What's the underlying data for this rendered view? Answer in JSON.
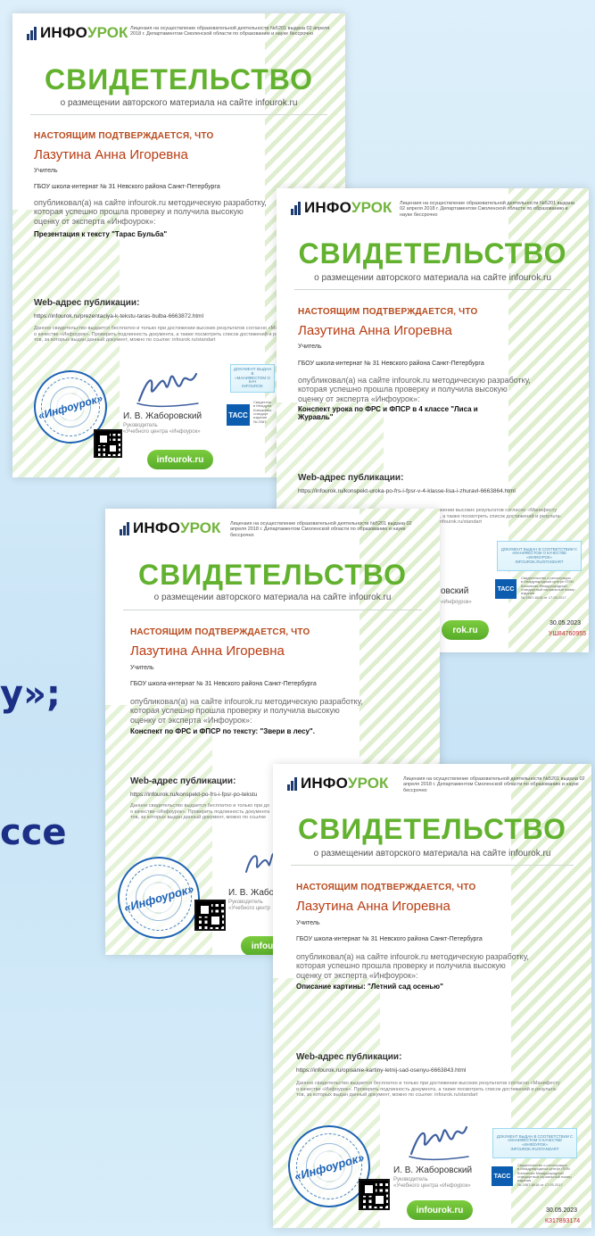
{
  "background": {
    "fragments": [
      "у»;",
      "ссе"
    ]
  },
  "certificates": [
    {
      "logo": {
        "brand_main": "ИНФО",
        "brand_accent": "УРОК"
      },
      "license_text": "Лицензия на осуществление образовательной деятельности №5201 выдана 02 апреля 2018 г.\nДепартаментом Смоленской области по образованию и науке бессрочно",
      "title": "СВИДЕТЕЛЬСТВО",
      "subtitle": "о размещении авторского материала на сайте infourok.ru",
      "confirm": "НАСТОЯЩИМ ПОДТВЕРЖДАЕТСЯ, ЧТО",
      "name": "Лазутина Анна Игоревна",
      "role": "Учитель",
      "school": "ГБОУ школа-интернат № 31 Невского района Санкт-Петербурга",
      "body": "опубликовал(а) на сайте infourok.ru методическую разработку,\nкоторая успешно прошла проверку и получила высокую\nоценку от эксперта «Инфоурок»:",
      "work": "Презентация к тексту \"Тарас Бульба\"",
      "web_label": "Web-адрес публикации:",
      "url": "https://infourok.ru/prezentaciya-k-tekstu-taras-bulba-6663872.html",
      "disclaimer": "Данное свидетельство выдается бесплатно и только при достижении высоких результатов согласно «Манифесту\nо качестве «Инфоурок». Проверить подлинность документа, а также посмотреть список достижений и результа-\nтов, за которых выдан данный документ, можно по ссылке: infourok.ru/standart",
      "seal_text": "«Инфоурок»",
      "signer_name": "И. В. Жаборовский",
      "signer_role": "Руководитель\n«Учебного центра «Инфоурок»",
      "site_button": "infourok.ru",
      "badge_text": "ДОКУМЕНТ ВЫДАН В\n«МАНИФЕСТОМ О КАЧ\nINFOUROK",
      "tass_label": "ТАСС",
      "tass_text": "Свидетель\nв Междуна\nКовыжевск\nстандарт\nиздания\n№ 2587-"
    },
    {
      "logo": {
        "brand_main": "ИНФО",
        "brand_accent": "УРОК"
      },
      "license_text": "Лицензия на осуществление образовательной деятельности №5201 выдана 02 апреля 2018 г.\nДепартаментом Смоленской области по образованию и науке бессрочно",
      "title": "СВИДЕТЕЛЬСТВО",
      "subtitle": "о размещении авторского материала на сайте infourok.ru",
      "confirm": "НАСТОЯЩИМ ПОДТВЕРЖДАЕТСЯ, ЧТО",
      "name": "Лазутина Анна Игоревна",
      "role": "Учитель",
      "school": "ГБОУ школа-интернат № 31 Невского района Санкт-Петербурга",
      "body": "опубликовал(а) на сайте infourok.ru методическую разработку,\nкоторая успешно прошла проверку и получила высокую\nоценку от эксперта «Инфоурок»:",
      "work": "Конспект урока по ФРС и ФПСР в 4 классе \"Лиса и\nЖуравль\"",
      "web_label": "Web-адрес публикации:",
      "url": "https://infourok.ru/konspekt-uroka-po-frs-i-fpsr-v-4-klasse-lisa-i-zhuravl-6663864.html",
      "disclaimer": "жении высоких результатов согласно «Манифесту\n, а также посмотреть список достижений и результа-\nnfourok.ru/standart",
      "signer_name_partial": "овский",
      "signer_role_partial": "«Инфоурок»",
      "site_button": "rok.ru",
      "badge_text": "ДОКУМЕНТ ВЫДАН В СООТВЕТСТВИИ С\n«МАНИФЕСТОМ О КАЧЕСТВЕ «ИНФОУРОК»\nINFOUROK.RU/STANDART",
      "tass_label": "ТАСС",
      "tass_text": "Свидетельство о регистрации\nв Международном центре ISSN\nКоизнесия Международный\nстандартный сериальный номер\nиздания\n№ 2587-8018 от 17.05.2017",
      "date": "30.05.2023",
      "serial": "УШ84760955"
    },
    {
      "logo": {
        "brand_main": "ИНФО",
        "brand_accent": "УРОК"
      },
      "license_text": "Лицензия на осуществление образовательной деятельности №5201 выдана 02 апреля 2018 г.\nДепартаментом Смоленской области по образованию и науке бессрочно",
      "title": "СВИДЕТЕЛЬСТВО",
      "subtitle": "о размещении авторского материала на сайте infourok.ru",
      "confirm": "НАСТОЯЩИМ ПОДТВЕРЖДАЕТСЯ, ЧТО",
      "name": "Лазутина Анна Игоревна",
      "role": "Учитель",
      "school": "ГБОУ школа-интернат № 31 Невского района Санкт-Петербурга",
      "body": "опубликовал(а) на сайте infourok.ru методическую разработку,\nкоторая успешно прошла проверку и получила высокую\nоценку от эксперта «Инфоурок»:",
      "work": "Конспект по ФРС и ФПСР по тексту: \"Звери в лесу\".",
      "web_label": "Web-адрес публикации:",
      "url": "https://infourok.ru/konspekt-po-frs-i-fpsr-po-tekstu",
      "disclaimer": "Данное свидетельство выдается бесплатно и только при до\nо качестве «Инфоурок». Проверить подлинность документа\nтов, за которых выдан данный документ, можно по ссылке",
      "seal_text": "«Инфоурок»",
      "signer_name": "И. В. Жабор",
      "signer_role": "Руководитель\n«Учебного центр",
      "site_button": "infou"
    },
    {
      "logo": {
        "brand_main": "ИНФО",
        "brand_accent": "УРОК"
      },
      "license_text": "Лицензия на осуществление образовательной деятельности №5201 выдана 02 апреля 2018 г.\nДепартаментом Смоленской области по образованию и науке бессрочно",
      "title": "СВИДЕТЕЛЬСТВО",
      "subtitle": "о размещении авторского материала на сайте infourok.ru",
      "confirm": "НАСТОЯЩИМ ПОДТВЕРЖДАЕТСЯ, ЧТО",
      "name": "Лазутина Анна Игоревна",
      "role": "Учитель",
      "school": "ГБОУ школа-интернат № 31 Невского района Санкт-Петербурга",
      "body": "опубликовал(а) на сайте infourok.ru методическую разработку,\nкоторая успешно прошла проверку и получила высокую\nоценку от эксперта «Инфоурок»:",
      "work": "Описание картины: \"Летний сад осенью\"",
      "web_label": "Web-адрес публикации:",
      "url": "https://infourok.ru/opisanie-kartiny-letnij-sad-osenyu-6663843.html",
      "disclaimer": "Данное свидетельство выдается бесплатно и только при достижении высоких результатов согласно «Манифесту\nо качестве «Инфоурок». Проверить подлинность документа, а также посмотреть список достижений и результа-\nтов, за которых выдан данный документ, можно по ссылке: infourok.ru/standart",
      "seal_text": "«Инфоурок»",
      "signer_name": "И. В. Жаборовский",
      "signer_role": "Руководитель\n«Учебного центра «Инфоурок»",
      "site_button": "infourok.ru",
      "badge_text": "ДОКУМЕНТ ВЫДАН В СООТВЕТСТВИИ С\n«МАНИФЕСТОМ О КАЧЕСТВЕ «ИНФОУРОК»\nINFOUROK.RU/STANDART",
      "tass_label": "ТАСС",
      "tass_text": "Свидетельство о регистрации\nв Международном центре ISSN\nКоизнесия Международный\nстандартный сериальный номер\nиздания\n№ 2587-8018 от 17.05.2017",
      "date": "30.05.2023",
      "serial": "К317893174"
    }
  ]
}
